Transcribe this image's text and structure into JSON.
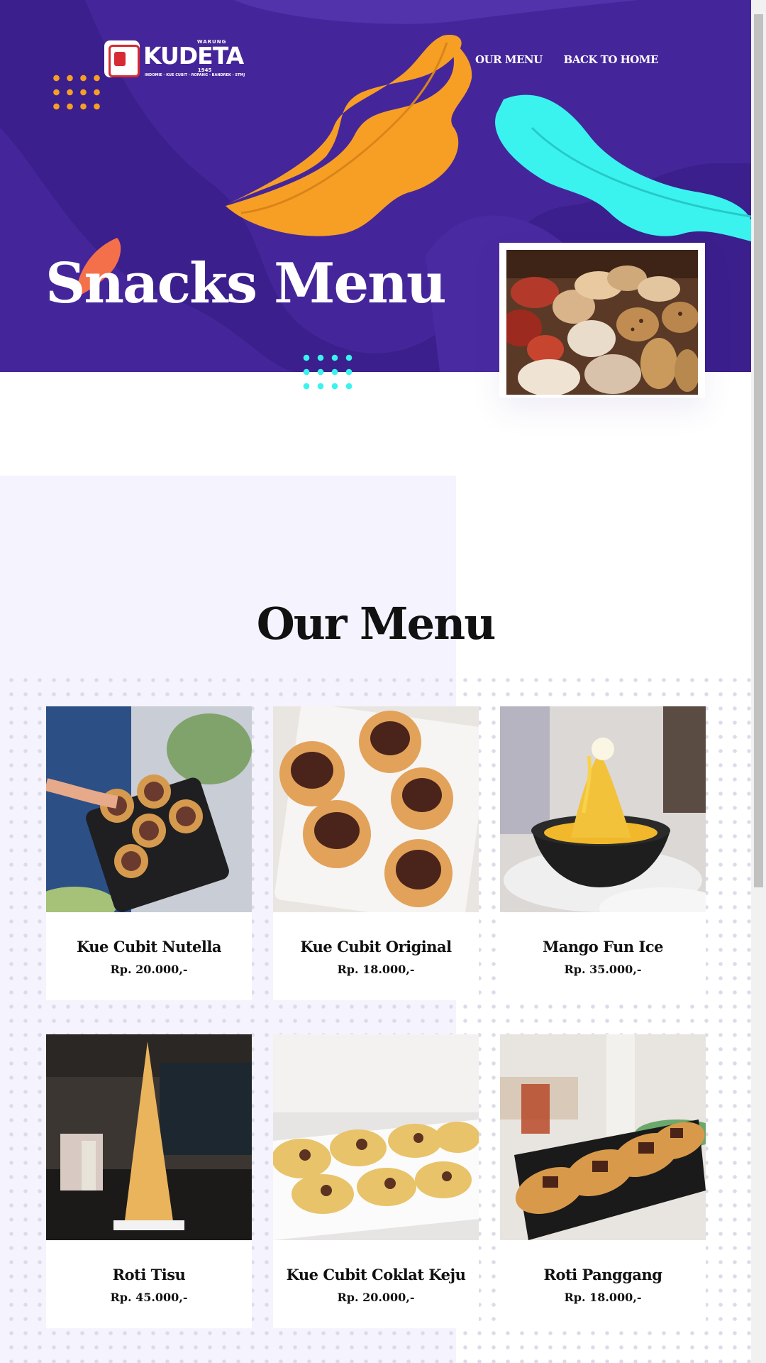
{
  "brand": {
    "small_top": "WARUNG",
    "name": "KUDETA",
    "year": "1945",
    "tagline": "INDOMIE - KUE CUBIT - ROPANG - BANDREK - STMJ"
  },
  "nav": {
    "items": [
      {
        "label": "OUR MENU"
      },
      {
        "label": "BACK TO HOME"
      }
    ]
  },
  "hero": {
    "title": "Snacks Menu",
    "photo_icon": "pastries-photo"
  },
  "menu": {
    "title": "Our Menu",
    "items": [
      {
        "name": "Kue Cubit Nutella",
        "price": "Rp. 20.000,-",
        "icon": "kue-cubit-nutella-photo"
      },
      {
        "name": "Kue Cubit Original",
        "price": "Rp. 18.000,-",
        "icon": "kue-cubit-original-photo"
      },
      {
        "name": "Mango Fun Ice",
        "price": "Rp. 35.000,-",
        "icon": "mango-fun-ice-photo"
      },
      {
        "name": "Roti Tisu",
        "price": "Rp. 45.000,-",
        "icon": "roti-tisu-photo"
      },
      {
        "name": "Kue Cubit Coklat Keju",
        "price": "Rp. 20.000,-",
        "icon": "kue-cubit-coklat-keju-photo"
      },
      {
        "name": "Roti Panggang",
        "price": "Rp. 18.000,-",
        "icon": "roti-panggang-photo"
      }
    ]
  },
  "colors": {
    "hero_bg": "#3b1f8c",
    "accent_orange": "#f79f24",
    "accent_cyan": "#3af3ef",
    "accent_coral": "#f4704a",
    "section_bg": "#f5f3fd"
  }
}
